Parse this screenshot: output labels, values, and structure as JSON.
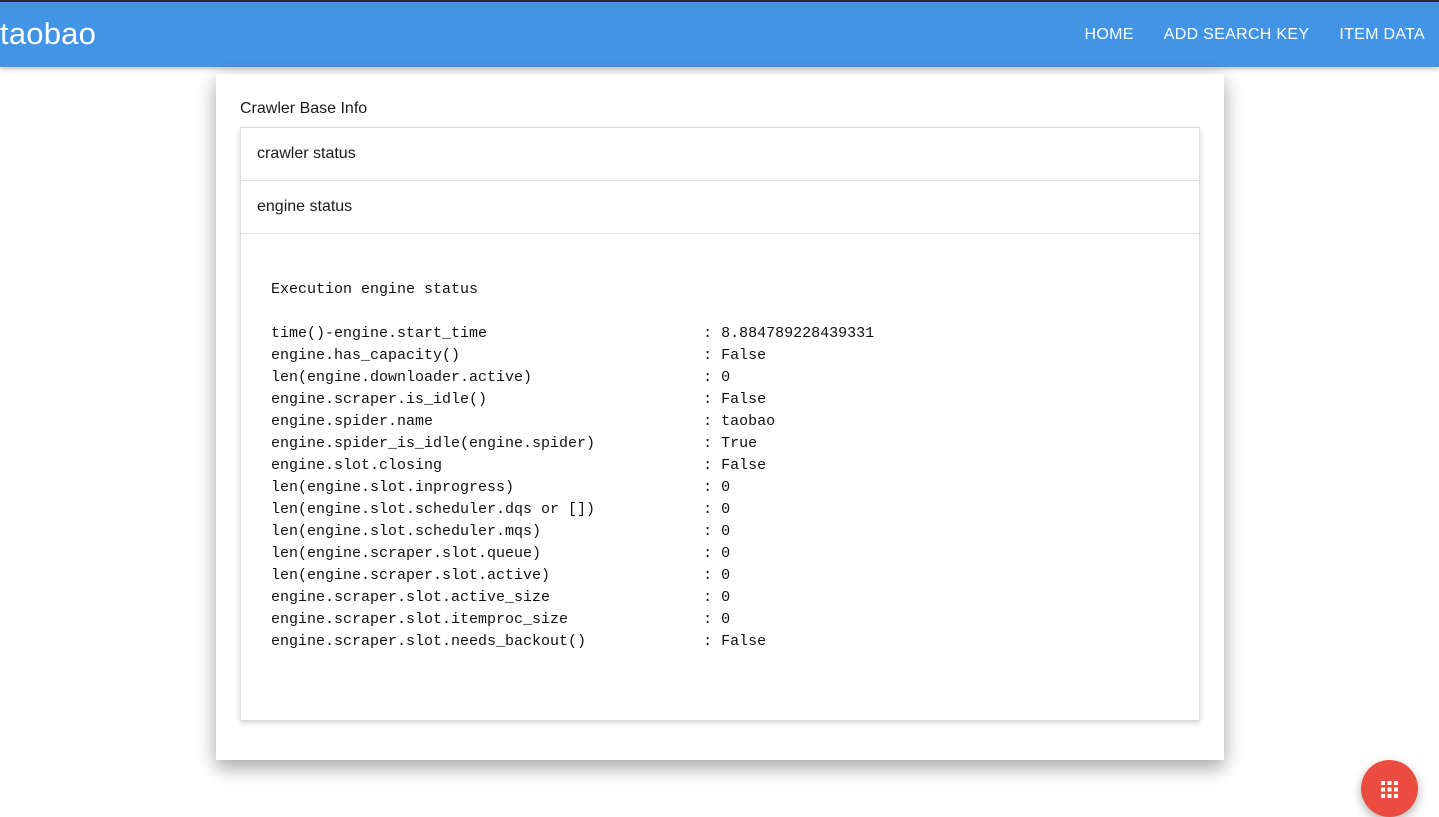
{
  "header": {
    "brand": "taobao",
    "nav": [
      "HOME",
      "ADD SEARCH KEY",
      "ITEM DATA"
    ]
  },
  "card": {
    "title": "Crawler Base Info",
    "sections": [
      "crawler status",
      "engine status"
    ],
    "engine_status_text": "Execution engine status\n\ntime()-engine.start_time                        : 8.884789228439331\nengine.has_capacity()                           : False\nlen(engine.downloader.active)                   : 0\nengine.scraper.is_idle()                        : False\nengine.spider.name                              : taobao\nengine.spider_is_idle(engine.spider)            : True\nengine.slot.closing                             : False\nlen(engine.slot.inprogress)                     : 0\nlen(engine.slot.scheduler.dqs or [])            : 0\nlen(engine.slot.scheduler.mqs)                  : 0\nlen(engine.scraper.slot.queue)                  : 0\nlen(engine.scraper.slot.active)                 : 0\nengine.scraper.slot.active_size                 : 0\nengine.scraper.slot.itemproc_size               : 0\nengine.scraper.slot.needs_backout()             : False"
  },
  "fab": {
    "icon": "apps-grid-icon"
  },
  "colors": {
    "topbar": "#4294e6",
    "fab": "#ea4d3f"
  }
}
